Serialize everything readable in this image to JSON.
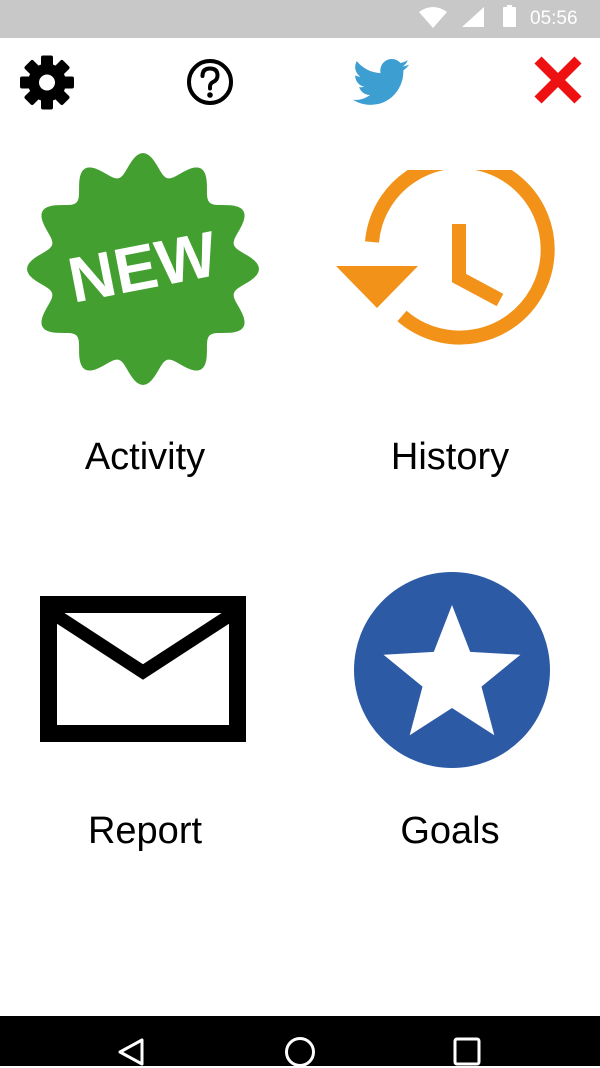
{
  "status_bar": {
    "time": "05:56",
    "icons": [
      "wifi-icon",
      "cellular-signal-icon",
      "battery-icon"
    ]
  },
  "toolbar": {
    "icons": [
      "settings-icon",
      "help-icon",
      "twitter-icon",
      "close-icon"
    ]
  },
  "tiles": [
    {
      "label": "Activity",
      "icon": "new-badge-icon",
      "badge_text": "NEW",
      "color": "#43a030"
    },
    {
      "label": "History",
      "icon": "history-clock-icon",
      "color": "#f29218"
    },
    {
      "label": "Report",
      "icon": "envelope-icon",
      "color": "#000000"
    },
    {
      "label": "Goals",
      "icon": "star-circle-icon",
      "color": "#2d5aa5"
    }
  ],
  "nav_bar": {
    "buttons": [
      "back-icon",
      "home-icon",
      "recents-icon"
    ]
  },
  "colors": {
    "status_bar": "#c8c8c8",
    "close": "#ee1111",
    "twitter": "#3d9ed2"
  }
}
